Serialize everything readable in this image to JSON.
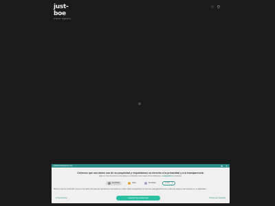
{
  "header": {
    "logo_main": "just-boe",
    "logo_sub": "travel agency",
    "icons": [
      "heart-icon",
      "cart-icon"
    ]
  },
  "loader": {
    "icon": "spinner-icon"
  },
  "consent": {
    "domain": "justboetravelagency.com",
    "bar_icons": [
      "globe-icon",
      "close-icon"
    ],
    "headline": "Creemos que sus datos son de su propiedad y respaldamos su derecho a la privacidad y a la transparencia.",
    "subline_prefix": "Elija un nivel de acceso a los datos y su duración para elegir cómo utilizamos y",
    "subline_link": "compartimos",
    "subline_suffix": "sus datos.",
    "levels": [
      {
        "label": "PLATINO",
        "selected": true
      },
      {
        "label": "ORO",
        "selected": false
      },
      {
        "label": "PLATINO",
        "selected": false
      }
    ],
    "duration": "1 mes",
    "description": "Máximo nivel de privacidad. Acceso a los datos solo para las operaciones necesarias en el sitio. Datos compartidos con terceros para garantizar que el sitio sea seguro y que funcione en su dispositivo.",
    "customize_link": "Personalizar",
    "save_button": "Guardar mis preferencias",
    "privacy_link": "Política de privacidad",
    "colors": {
      "accent": "#2a8f8a",
      "button": "#2bbfa4",
      "panel": "#f0f0f0",
      "page": "#1a1a1a"
    }
  }
}
